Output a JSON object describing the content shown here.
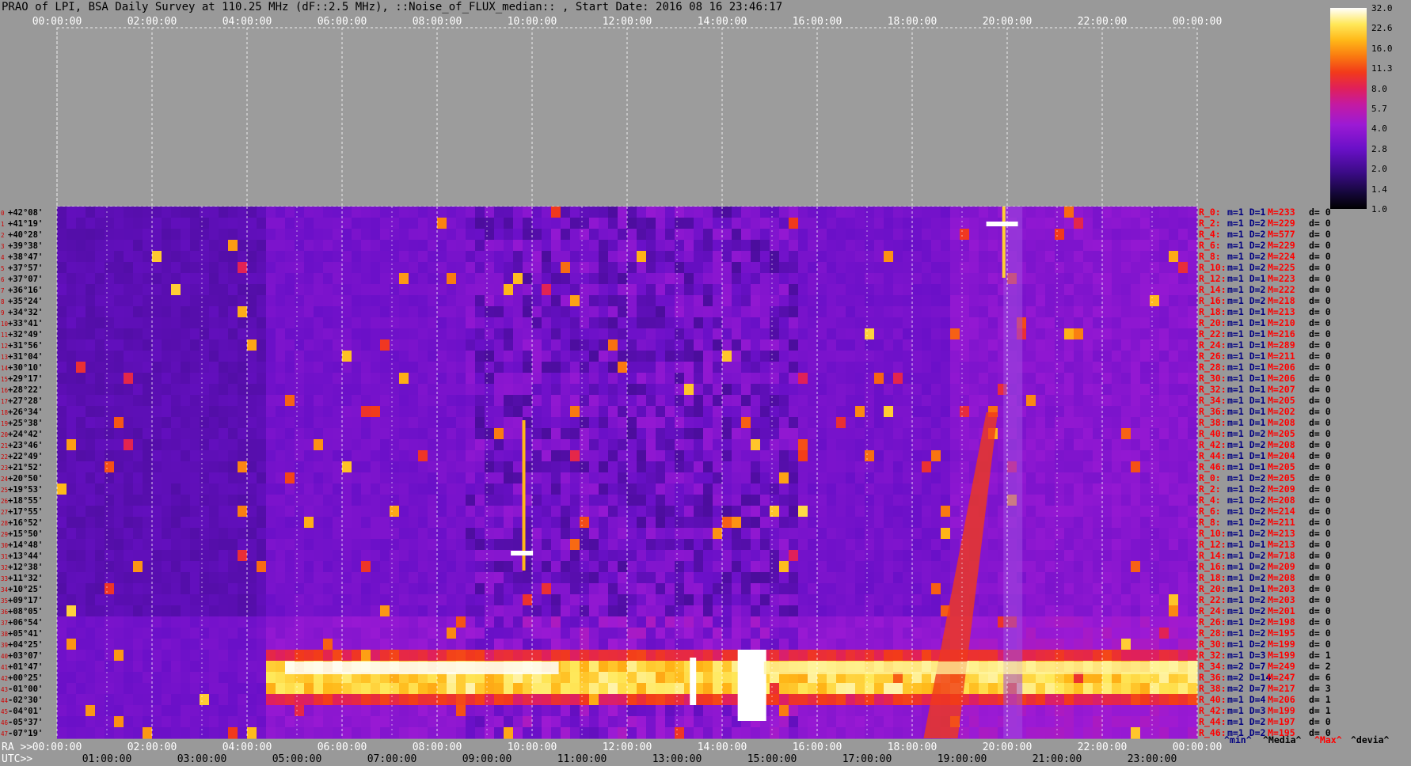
{
  "title": "PRAO of LPI, BSA Daily Survey at 110.25 MHz (dF::2.5 MHz), ::Noise_of_FLUX_median:: , Start Date: 2016 08 16 23:46:17",
  "colorbar": {
    "ticks": [
      "32.0",
      "22.6",
      "16.0",
      "11.3",
      "8.0",
      "5.7",
      "4.0",
      "2.8",
      "2.0",
      "1.4",
      "1.0"
    ]
  },
  "footer": {
    "ra_label": "RA >>",
    "utc_label": "UTC>>"
  },
  "legend": {
    "min": "^min^",
    "median": "^Media^",
    "max": "^Max^",
    "devia": "^devia^"
  },
  "colors": {
    "stat_red": "#ff0000",
    "stat_navy": "#000080",
    "left_red": "#d00000"
  },
  "chart_data": {
    "type": "heatmap",
    "colorscale_range": [
      1.0,
      32.0
    ],
    "top_axis": [
      "00:00:00",
      "02:00:00",
      "04:00:00",
      "06:00:00",
      "08:00:00",
      "10:00:00",
      "12:00:00",
      "14:00:00",
      "16:00:00",
      "18:00:00",
      "20:00:00",
      "22:00:00",
      "00:00:00"
    ],
    "ra_axis": [
      "00:00:00",
      "02:00:00",
      "04:00:00",
      "06:00:00",
      "08:00:00",
      "10:00:00",
      "12:00:00",
      "14:00:00",
      "16:00:00",
      "18:00:00",
      "20:00:00",
      "22:00:00",
      "00:00:00"
    ],
    "utc_axis": [
      "01:00:00",
      "03:00:00",
      "05:00:00",
      "07:00:00",
      "09:00:00",
      "11:00:00",
      "13:00:00",
      "15:00:00",
      "17:00:00",
      "19:00:00",
      "21:00:00",
      "23:00:00"
    ],
    "declinations": [
      "+42°08'",
      "+41°19'",
      "+40°28'",
      "+39°38'",
      "+38°47'",
      "+37°57'",
      "+37°07'",
      "+36°16'",
      "+35°24'",
      "+34°32'",
      "+33°41'",
      "+32°49'",
      "+31°56'",
      "+31°04'",
      "+30°10'",
      "+29°17'",
      "+28°22'",
      "+27°28'",
      "+26°34'",
      "+25°38'",
      "+24°42'",
      "+23°46'",
      "+22°49'",
      "+21°52'",
      "+20°50'",
      "+19°53'",
      "+18°55'",
      "+17°55'",
      "+16°52'",
      "+15°50'",
      "+14°48'",
      "+13°44'",
      "+12°38'",
      "+11°32'",
      "+10°25'",
      "+09°17'",
      "+08°05'",
      "+06°54'",
      "+05°41'",
      "+04°25'",
      "+03°07'",
      "+01°47'",
      "+00°25'",
      "-01°00'",
      "-02°30'",
      "-04°01'",
      "-05°37'",
      "-07°19'"
    ],
    "row_stats": [
      [
        "R_0:",
        "m=1 D=1",
        "M=233",
        "d= 0"
      ],
      [
        "R_2:",
        "m=1 D=2",
        "M=229",
        "d= 0"
      ],
      [
        "R_4:",
        "m=1 D=2",
        "M=577",
        "d= 0"
      ],
      [
        "R_6:",
        "m=1 D=2",
        "M=229",
        "d= 0"
      ],
      [
        "R_8:",
        "m=1 D=2",
        "M=224",
        "d= 0"
      ],
      [
        "R_10:",
        "m=1 D=2",
        "M=225",
        "d= 0"
      ],
      [
        "R_12:",
        "m=1 D=1",
        "M=223",
        "d= 0"
      ],
      [
        "R_14:",
        "m=1 D=2",
        "M=222",
        "d= 0"
      ],
      [
        "R_16:",
        "m=1 D=2",
        "M=218",
        "d= 0"
      ],
      [
        "R_18:",
        "m=1 D=1",
        "M=213",
        "d= 0"
      ],
      [
        "R_20:",
        "m=1 D=1",
        "M=210",
        "d= 0"
      ],
      [
        "R_22:",
        "m=1 D=1",
        "M=216",
        "d= 0"
      ],
      [
        "R_24:",
        "m=1 D=1",
        "M=289",
        "d= 0"
      ],
      [
        "R_26:",
        "m=1 D=1",
        "M=211",
        "d= 0"
      ],
      [
        "R_28:",
        "m=1 D=1",
        "M=206",
        "d= 0"
      ],
      [
        "R_30:",
        "m=1 D=1",
        "M=206",
        "d= 0"
      ],
      [
        "R_32:",
        "m=1 D=1",
        "M=207",
        "d= 0"
      ],
      [
        "R_34:",
        "m=1 D=1",
        "M=205",
        "d= 0"
      ],
      [
        "R_36:",
        "m=1 D=1",
        "M=202",
        "d= 0"
      ],
      [
        "R_38:",
        "m=1 D=1",
        "M=208",
        "d= 0"
      ],
      [
        "R_40:",
        "m=1 D=2",
        "M=205",
        "d= 0"
      ],
      [
        "R_42:",
        "m=1 D=2",
        "M=208",
        "d= 0"
      ],
      [
        "R_44:",
        "m=1 D=1",
        "M=204",
        "d= 0"
      ],
      [
        "R_46:",
        "m=1 D=1",
        "M=205",
        "d= 0"
      ],
      [
        "R_0:",
        "m=1 D=2",
        "M=205",
        "d= 0"
      ],
      [
        "R_2:",
        "m=1 D=2",
        "M=209",
        "d= 0"
      ],
      [
        "R_4:",
        "m=1 D=2",
        "M=208",
        "d= 0"
      ],
      [
        "R_6:",
        "m=1 D=2",
        "M=214",
        "d= 0"
      ],
      [
        "R_8:",
        "m=1 D=2",
        "M=211",
        "d= 0"
      ],
      [
        "R_10:",
        "m=1 D=2",
        "M=213",
        "d= 0"
      ],
      [
        "R_12:",
        "m=1 D=1",
        "M=213",
        "d= 0"
      ],
      [
        "R_14:",
        "m=1 D=2",
        "M=718",
        "d= 0"
      ],
      [
        "R_16:",
        "m=1 D=2",
        "M=209",
        "d= 0"
      ],
      [
        "R_18:",
        "m=1 D=2",
        "M=208",
        "d= 0"
      ],
      [
        "R_20:",
        "m=1 D=1",
        "M=203",
        "d= 0"
      ],
      [
        "R_22:",
        "m=1 D=2",
        "M=203",
        "d= 0"
      ],
      [
        "R_24:",
        "m=1 D=2",
        "M=201",
        "d= 0"
      ],
      [
        "R_26:",
        "m=1 D=2",
        "M=198",
        "d= 0"
      ],
      [
        "R_28:",
        "m=1 D=2",
        "M=195",
        "d= 0"
      ],
      [
        "R_30:",
        "m=1 D=2",
        "M=199",
        "d= 0"
      ],
      [
        "R_32:",
        "m=1 D=3",
        "M=199",
        "d= 1"
      ],
      [
        "R_34:",
        "m=2 D=7",
        "M=249",
        "d= 2"
      ],
      [
        "R_36:",
        "m=2 D=14",
        "M=247",
        "d= 6"
      ],
      [
        "R_38:",
        "m=2 D=7",
        "M=217",
        "d= 3"
      ],
      [
        "R_40:",
        "m=1 D=4",
        "M=206",
        "d= 1"
      ],
      [
        "R_42:",
        "m=1 D=3",
        "M=199",
        "d= 1"
      ],
      [
        "R_44:",
        "m=1 D=2",
        "M=197",
        "d= 0"
      ],
      [
        "R_46:",
        "m=1 D=2",
        "M=195",
        "d= 0"
      ]
    ],
    "strong_band_rows": [
      41,
      42,
      43
    ]
  }
}
